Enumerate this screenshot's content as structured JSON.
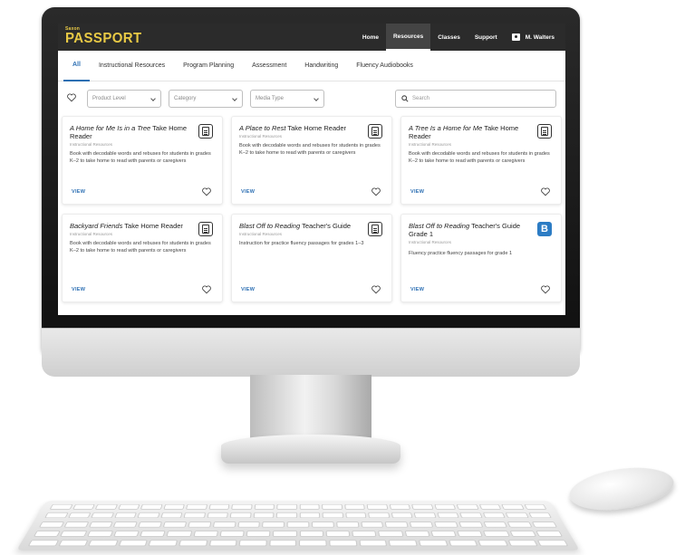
{
  "app": {
    "logo_small": "Saxon",
    "logo_main": "PASSPORT"
  },
  "nav": {
    "items": [
      {
        "label": "Home",
        "active": false
      },
      {
        "label": "Resources",
        "active": true
      },
      {
        "label": "Classes",
        "active": false
      },
      {
        "label": "Support",
        "active": false
      }
    ],
    "user_name": "M. Walters",
    "user_icon": "user-card-icon"
  },
  "tabs": [
    {
      "label": "All",
      "active": true
    },
    {
      "label": "Instructional Resources",
      "active": false
    },
    {
      "label": "Program Planning",
      "active": false
    },
    {
      "label": "Assessment",
      "active": false
    },
    {
      "label": "Handwriting",
      "active": false
    },
    {
      "label": "Fluency Audiobooks",
      "active": false
    }
  ],
  "filters": {
    "favorites_icon": "heart-icon",
    "product_level": "Product Level",
    "category": "Category",
    "media_type": "Media Type",
    "search_placeholder": "Search"
  },
  "cards": [
    {
      "title_italic": "A Home for Me Is in a Tree",
      "title_rest": " Take Home Reader",
      "subtitle": "Instructional Resources",
      "description": "Book with decodable words and rebuses for students in grades K–2 to take home to read with parents or caregivers",
      "view": "VIEW",
      "icon": "document-icon"
    },
    {
      "title_italic": "A Place to Rest",
      "title_rest": " Take Home Reader",
      "subtitle": "Instructional Resources",
      "description": "Book with decodable words and rebuses for students in grades K–2 to take home to read with parents or caregivers",
      "view": "VIEW",
      "icon": "document-icon"
    },
    {
      "title_italic": "A Tree Is a Home for Me",
      "title_rest": " Take Home Reader",
      "subtitle": "Instructional Resources",
      "description": "Book with decodable words and rebuses for students in grades K–2 to take home to read with parents or caregivers",
      "view": "VIEW",
      "icon": "document-icon"
    },
    {
      "title_italic": "Backyard Friends",
      "title_rest": " Take Home Reader",
      "subtitle": "Instructional Resources",
      "description": "Book with decodable words and rebuses for students in grades K–2 to take home to read with parents or caregivers",
      "view": "VIEW",
      "icon": "document-icon"
    },
    {
      "title_italic": "Blast Off to Reading",
      "title_rest": " Teacher's Guide",
      "subtitle": "Instructional Resources",
      "description": "Instruction for practice fluency passages for grades 1–3",
      "view": "VIEW",
      "icon": "document-icon"
    },
    {
      "title_italic": "Blast Off to Reading",
      "title_rest": " Teacher's Guide Grade 1",
      "subtitle": "Instructional Resources",
      "description": "Fluency practice fluency passages for grade 1",
      "view": "VIEW",
      "icon": "b-app-icon",
      "icon_text": "B"
    }
  ],
  "colors": {
    "topbar": "#2b2b2b",
    "logo": "#e8c945",
    "accent": "#2c6fb3",
    "b_icon": "#2c7cc4"
  }
}
